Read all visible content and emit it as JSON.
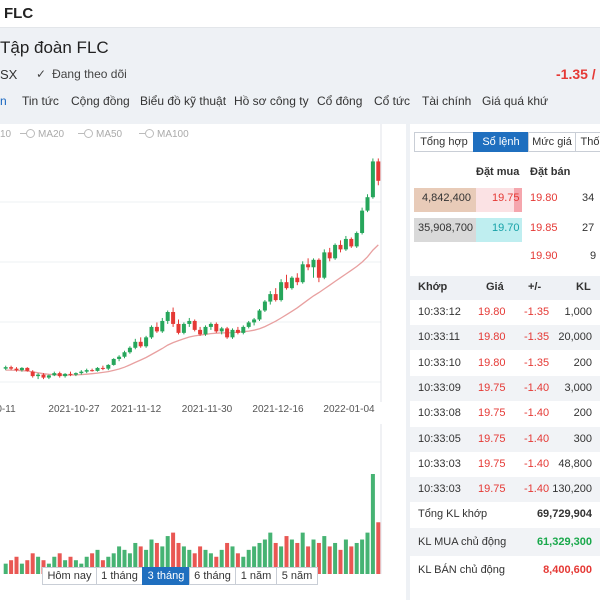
{
  "header": {
    "ticker": "FLC",
    "company": "Tập đoàn FLC",
    "exchange": "SX",
    "follow_label": "Đang theo dõi",
    "price_change": "-1.35 /"
  },
  "tabs": [
    "n",
    "Tin tức",
    "Cộng đồng",
    "Biểu đồ kỹ thuật",
    "Hồ sơ công ty",
    "Cổ đông",
    "Cổ tức",
    "Tài chính",
    "Giá quá khứ"
  ],
  "chart": {
    "legend": [
      "10",
      "MA20",
      "MA50",
      "MA100"
    ],
    "range_buttons": [
      "Hôm nay",
      "1 tháng",
      "3 tháng",
      "6 tháng",
      "1 năm",
      "5 năm"
    ],
    "active_range": "3 tháng"
  },
  "chart_data": {
    "type": "candlestick",
    "x_tick_labels": [
      "0-11",
      "2021-10-27",
      "2021-11-12",
      "2021-11-30",
      "2021-12-16",
      "2022-01-04"
    ],
    "candles": [
      [
        7.2,
        7.4,
        7.1,
        7.3
      ],
      [
        7.3,
        7.4,
        7.1,
        7.2
      ],
      [
        7.2,
        7.3,
        7.0,
        7.1
      ],
      [
        7.1,
        7.3,
        7.0,
        7.25
      ],
      [
        7.25,
        7.3,
        7.0,
        7.05
      ],
      [
        7.0,
        7.1,
        6.6,
        6.7
      ],
      [
        6.7,
        6.9,
        6.5,
        6.8
      ],
      [
        6.8,
        6.9,
        6.5,
        6.6
      ],
      [
        6.6,
        6.8,
        6.5,
        6.75
      ],
      [
        6.75,
        7.0,
        6.7,
        6.9
      ],
      [
        6.9,
        7.0,
        6.6,
        6.7
      ],
      [
        6.7,
        6.9,
        6.6,
        6.85
      ],
      [
        6.85,
        7.0,
        6.7,
        6.8
      ],
      [
        6.8,
        6.95,
        6.7,
        6.9
      ],
      [
        6.9,
        7.1,
        6.8,
        7.0
      ],
      [
        7.0,
        7.2,
        6.9,
        7.1
      ],
      [
        7.1,
        7.2,
        7.0,
        7.05
      ],
      [
        7.05,
        7.3,
        7.0,
        7.25
      ],
      [
        7.25,
        7.4,
        7.1,
        7.2
      ],
      [
        7.2,
        7.5,
        7.1,
        7.45
      ],
      [
        7.45,
        7.9,
        7.4,
        7.85
      ],
      [
        7.85,
        8.1,
        7.7,
        8.0
      ],
      [
        8.0,
        8.4,
        7.9,
        8.3
      ],
      [
        8.3,
        8.7,
        8.2,
        8.6
      ],
      [
        8.6,
        9.2,
        8.5,
        9.0
      ],
      [
        9.0,
        9.3,
        8.6,
        8.7
      ],
      [
        8.7,
        9.4,
        8.6,
        9.3
      ],
      [
        9.3,
        10.1,
        9.2,
        10.0
      ],
      [
        10.0,
        10.3,
        9.6,
        9.7
      ],
      [
        9.7,
        10.6,
        9.6,
        10.4
      ],
      [
        10.4,
        11.1,
        10.2,
        11.0
      ],
      [
        11.0,
        11.3,
        10.0,
        10.2
      ],
      [
        10.2,
        10.5,
        9.5,
        9.6
      ],
      [
        9.6,
        10.3,
        9.5,
        10.2
      ],
      [
        10.2,
        10.6,
        10.0,
        10.4
      ],
      [
        10.4,
        10.5,
        9.7,
        9.8
      ],
      [
        9.8,
        10.0,
        9.4,
        9.5
      ],
      [
        9.5,
        10.1,
        9.4,
        10.0
      ],
      [
        10.0,
        10.3,
        9.8,
        10.2
      ],
      [
        10.2,
        10.3,
        9.6,
        9.7
      ],
      [
        9.7,
        10.0,
        9.5,
        9.9
      ],
      [
        9.9,
        10.0,
        9.2,
        9.3
      ],
      [
        9.3,
        9.9,
        9.2,
        9.8
      ],
      [
        9.8,
        10.0,
        9.5,
        9.6
      ],
      [
        9.6,
        10.1,
        9.5,
        10.0
      ],
      [
        10.0,
        10.4,
        9.9,
        10.3
      ],
      [
        10.3,
        10.6,
        10.1,
        10.5
      ],
      [
        10.5,
        11.2,
        10.4,
        11.1
      ],
      [
        11.1,
        11.8,
        11.0,
        11.7
      ],
      [
        11.7,
        12.4,
        11.5,
        12.2
      ],
      [
        12.2,
        12.6,
        11.7,
        11.8
      ],
      [
        11.8,
        13.2,
        11.7,
        13.0
      ],
      [
        13.0,
        13.5,
        12.5,
        12.6
      ],
      [
        12.6,
        13.4,
        12.5,
        13.3
      ],
      [
        13.3,
        13.6,
        12.8,
        13.0
      ],
      [
        13.0,
        14.4,
        12.9,
        14.2
      ],
      [
        14.2,
        14.6,
        13.8,
        14.0
      ],
      [
        14.0,
        14.6,
        13.3,
        14.5
      ],
      [
        14.5,
        14.6,
        13.0,
        13.3
      ],
      [
        13.3,
        15.2,
        13.2,
        15.0
      ],
      [
        15.0,
        15.3,
        14.4,
        14.6
      ],
      [
        14.6,
        15.6,
        14.5,
        15.5
      ],
      [
        15.5,
        15.8,
        15.0,
        15.2
      ],
      [
        15.2,
        16.1,
        15.1,
        15.9
      ],
      [
        15.9,
        16.0,
        15.3,
        15.4
      ],
      [
        15.4,
        16.4,
        15.3,
        16.3
      ],
      [
        16.3,
        18.0,
        16.2,
        17.8
      ],
      [
        17.8,
        18.9,
        17.7,
        18.7
      ],
      [
        18.7,
        21.3,
        18.6,
        21.1
      ],
      [
        21.1,
        21.3,
        19.5,
        19.8
      ]
    ],
    "ma_line": [
      7.1,
      7.1,
      7.08,
      7.06,
      7.04,
      6.98,
      6.92,
      6.86,
      6.82,
      6.8,
      6.78,
      6.77,
      6.77,
      6.78,
      6.8,
      6.83,
      6.86,
      6.9,
      6.95,
      7.0,
      7.08,
      7.18,
      7.3,
      7.45,
      7.62,
      7.78,
      7.95,
      8.15,
      8.35,
      8.55,
      8.78,
      8.95,
      9.08,
      9.2,
      9.32,
      9.4,
      9.45,
      9.5,
      9.55,
      9.58,
      9.6,
      9.6,
      9.62,
      9.65,
      9.68,
      9.72,
      9.78,
      9.88,
      10.02,
      10.2,
      10.38,
      10.6,
      10.82,
      11.05,
      11.28,
      11.55,
      11.82,
      12.08,
      12.3,
      12.55,
      12.8,
      13.05,
      13.3,
      13.55,
      13.8,
      14.05,
      14.35,
      14.7,
      15.15,
      15.5
    ],
    "volume": [
      3,
      4,
      5,
      3,
      4,
      6,
      5,
      4,
      3,
      5,
      6,
      4,
      5,
      4,
      3,
      5,
      6,
      7,
      4,
      5,
      6,
      8,
      7,
      6,
      9,
      8,
      7,
      10,
      9,
      8,
      11,
      12,
      9,
      8,
      7,
      6,
      8,
      7,
      6,
      5,
      7,
      9,
      8,
      6,
      5,
      7,
      8,
      9,
      10,
      12,
      9,
      8,
      11,
      10,
      9,
      12,
      8,
      10,
      9,
      11,
      8,
      9,
      7,
      10,
      8,
      9,
      10,
      12,
      29,
      15
    ],
    "ylim": [
      5.5,
      22
    ]
  },
  "side": {
    "tabs": [
      "Tổng hợp",
      "Sổ lệnh",
      "Mức giá",
      "Thố"
    ],
    "active_tab": "Sổ lệnh",
    "ob_headers": {
      "buy": "Đặt mua",
      "sell": "Đặt bán"
    },
    "orderbook": [
      {
        "bid_vol": "4,842,400",
        "bid_price": "19.75",
        "ask_price": "19.80",
        "ask_vol": "34"
      },
      {
        "bid_vol": "35,908,700",
        "bid_price": "19.70",
        "ask_price": "19.85",
        "ask_vol": "27"
      },
      {
        "bid_vol": "",
        "bid_price": "",
        "ask_price": "19.90",
        "ask_vol": "9"
      }
    ],
    "trade_headers": [
      "Khớp",
      "Giá",
      "+/-",
      "KL"
    ],
    "trades": [
      {
        "time": "10:33:12",
        "price": "19.80",
        "change": "-1.35",
        "vol": "1,000"
      },
      {
        "time": "10:33:11",
        "price": "19.80",
        "change": "-1.35",
        "vol": "20,000"
      },
      {
        "time": "10:33:10",
        "price": "19.80",
        "change": "-1.35",
        "vol": "200"
      },
      {
        "time": "10:33:09",
        "price": "19.75",
        "change": "-1.40",
        "vol": "3,000"
      },
      {
        "time": "10:33:08",
        "price": "19.75",
        "change": "-1.40",
        "vol": "200"
      },
      {
        "time": "10:33:05",
        "price": "19.75",
        "change": "-1.40",
        "vol": "300"
      },
      {
        "time": "10:33:03",
        "price": "19.75",
        "change": "-1.40",
        "vol": "48,800"
      },
      {
        "time": "10:33:03",
        "price": "19.75",
        "change": "-1.40",
        "vol": "130,200"
      }
    ],
    "summary": [
      {
        "label": "Tổng KL khớp",
        "value": "69,729,904"
      },
      {
        "label": "KL MUA chủ động",
        "value": "61,329,300"
      },
      {
        "label": "KL BÁN chủ động",
        "value": "8,400,600"
      }
    ]
  },
  "colors": {
    "up": "#26a65b",
    "down": "#e53935",
    "ma": "#e8a0a0",
    "accent": "#1f6fbf"
  }
}
